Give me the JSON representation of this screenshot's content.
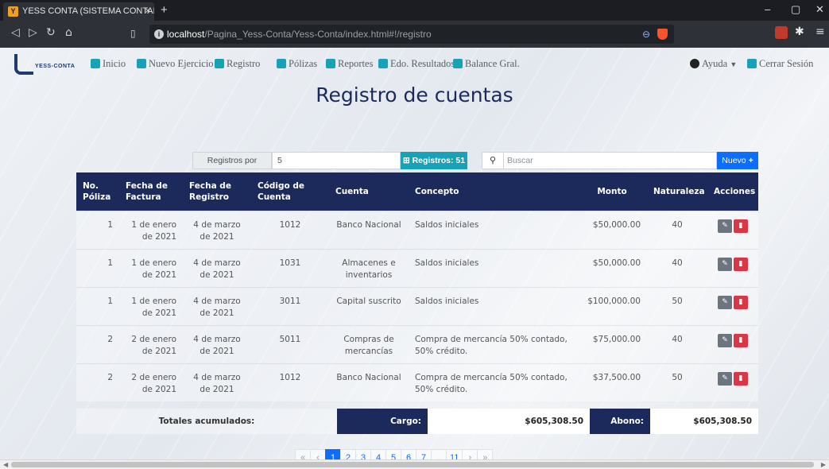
{
  "browser": {
    "tab_title": "YESS CONTA (SISTEMA CONTABL",
    "tab_close": "×",
    "new_tab": "+",
    "url_host": "localhost",
    "url_path": "/Pagina_Yess-Conta/Yess-Conta/index.html#!/registro",
    "min": "–",
    "max": "▢",
    "close": "✕"
  },
  "nav": {
    "logo": "YESS-CONTA",
    "links": [
      "Inicio",
      "Nuevo Ejercicio",
      "Registro",
      "Pólizas",
      "Reportes",
      "Edo. Resultados",
      "Balance Gral."
    ],
    "help": "Ayuda",
    "logout": "Cerrar Sesión"
  },
  "page_title": "Registro de cuentas",
  "toolbar": {
    "per_page_label": "Registros por página:",
    "per_page_value": "5",
    "records_badge": "Registros: 51",
    "search_placeholder": "Buscar",
    "new_button": "Nuevo"
  },
  "table": {
    "headers": [
      "No. Póliza",
      "Fecha de Factura",
      "Fecha de Registro",
      "Código de Cuenta",
      "Cuenta",
      "Concepto",
      "Monto",
      "Naturaleza",
      "Acciones"
    ],
    "rows": [
      {
        "poliza": "1",
        "fecha_factura": "1 de enero de 2021",
        "fecha_registro": "4 de marzo de 2021",
        "codigo": "1012",
        "cuenta": "Banco Nacional",
        "concepto": "Saldos iniciales",
        "monto": "$50,000.00",
        "naturaleza": "40"
      },
      {
        "poliza": "1",
        "fecha_factura": "1 de enero de 2021",
        "fecha_registro": "4 de marzo de 2021",
        "codigo": "1031",
        "cuenta": "Almacenes e inventarios",
        "concepto": "Saldos iniciales",
        "monto": "$50,000.00",
        "naturaleza": "40"
      },
      {
        "poliza": "1",
        "fecha_factura": "1 de enero de 2021",
        "fecha_registro": "4 de marzo de 2021",
        "codigo": "3011",
        "cuenta": "Capital suscrito",
        "concepto": "Saldos iniciales",
        "monto": "$100,000.00",
        "naturaleza": "50"
      },
      {
        "poliza": "2",
        "fecha_factura": "2 de enero de 2021",
        "fecha_registro": "4 de marzo de 2021",
        "codigo": "5011",
        "cuenta": "Compras de mercancías",
        "concepto": "Compra de mercancía 50% contado, 50% crédito.",
        "monto": "$75,000.00",
        "naturaleza": "40"
      },
      {
        "poliza": "2",
        "fecha_factura": "2 de enero de 2021",
        "fecha_registro": "4 de marzo de 2021",
        "codigo": "1012",
        "cuenta": "Banco Nacional",
        "concepto": "Compra de mercancía 50% contado, 50% crédito.",
        "monto": "$37,500.00",
        "naturaleza": "50"
      }
    ]
  },
  "totals": {
    "label": "Totales acumulados:",
    "cargo_label": "Cargo:",
    "cargo_value": "$605,308.50",
    "abono_label": "Abono:",
    "abono_value": "$605,308.50"
  },
  "pagination": [
    "«",
    "‹",
    "1",
    "2",
    "3",
    "4",
    "5",
    "6",
    "7",
    "...",
    "11",
    "›",
    "»"
  ],
  "pagination_active": "1"
}
